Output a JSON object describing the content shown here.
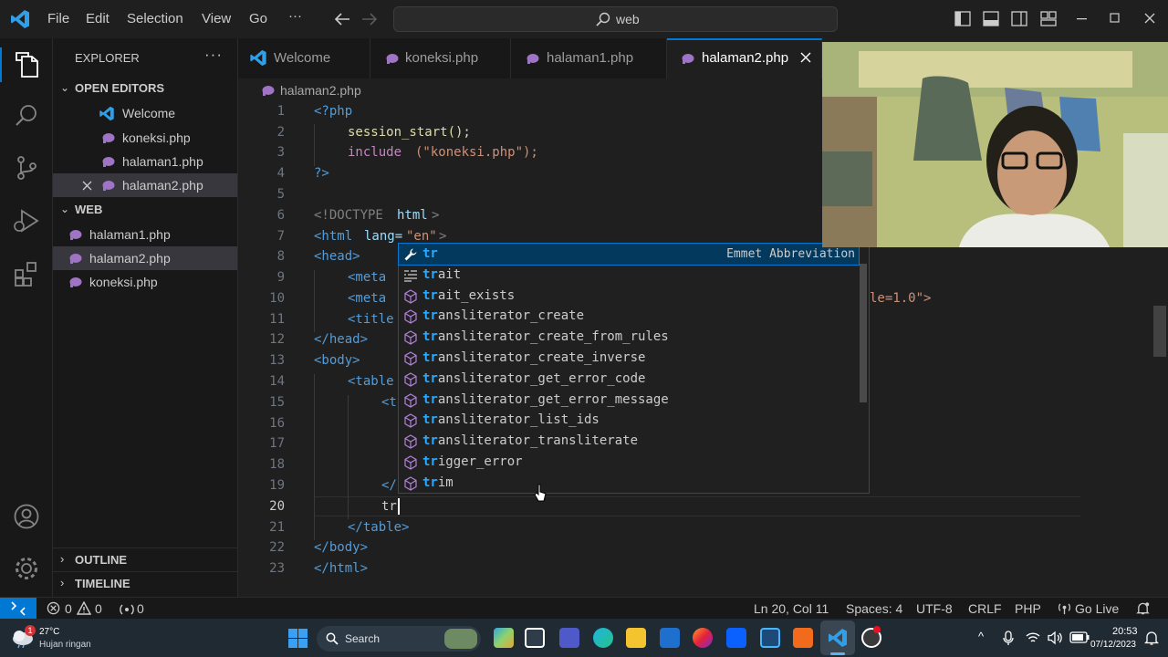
{
  "menu": {
    "file": "File",
    "edit": "Edit",
    "selection": "Selection",
    "view": "View",
    "go": "Go",
    "more": "···"
  },
  "search": {
    "text": "web"
  },
  "explorer": {
    "title": "EXPLORER",
    "open_editors_title": "OPEN EDITORS",
    "open_editors": [
      "Welcome",
      "koneksi.php",
      "halaman1.php",
      "halaman2.php"
    ],
    "folder_title": "WEB",
    "files": [
      "halaman1.php",
      "halaman2.php",
      "koneksi.php"
    ],
    "outline": "OUTLINE",
    "timeline": "TIMELINE"
  },
  "tabs": [
    {
      "label": "Welcome"
    },
    {
      "label": "koneksi.php"
    },
    {
      "label": "halaman1.php"
    },
    {
      "label": "halaman2.php"
    }
  ],
  "breadcrumb": "halaman2.php",
  "editor": {
    "line_numbers": [
      "1",
      "2",
      "3",
      "4",
      "5",
      "6",
      "7",
      "8",
      "9",
      "10",
      "11",
      "12",
      "13",
      "14",
      "15",
      "16",
      "17",
      "18",
      "19",
      "20",
      "21",
      "22",
      "23"
    ],
    "visible_fragments": {
      "l1": "<?php",
      "l2": "session_start();",
      "l3a": "include",
      "l3b": "(\"koneksi.php\");",
      "l4": "?>",
      "l6a": "<!DOCTYPE",
      "l6b": "html",
      "l6c": ">",
      "l7a": "<html",
      "l7b": "lang=",
      "l7c": "\"en\"",
      "l7d": ">",
      "l8": "<head>",
      "l9": "<meta",
      "l10": "<meta",
      "l10tail": "le=1.0\">",
      "l11": "<title",
      "l12": "</head>",
      "l13": "<body>",
      "l14": "<table",
      "l15": "<t",
      "l19": "</",
      "l20": "tr",
      "l21": "</table>",
      "l22": "</body>",
      "l23": "</html>"
    }
  },
  "suggestions": {
    "header_detail": "Emmet Abbreviation",
    "items": [
      {
        "match": "tr",
        "rest": ""
      },
      {
        "match": "tr",
        "rest": "ait"
      },
      {
        "match": "tr",
        "rest": "ait_exists"
      },
      {
        "match": "tr",
        "rest": "ansliterator_create"
      },
      {
        "match": "tr",
        "rest": "ansliterator_create_from_rules"
      },
      {
        "match": "tr",
        "rest": "ansliterator_create_inverse"
      },
      {
        "match": "tr",
        "rest": "ansliterator_get_error_code"
      },
      {
        "match": "tr",
        "rest": "ansliterator_get_error_message"
      },
      {
        "match": "tr",
        "rest": "ansliterator_list_ids"
      },
      {
        "match": "tr",
        "rest": "ansliterator_transliterate"
      },
      {
        "match": "tr",
        "rest": "igger_error"
      },
      {
        "match": "tr",
        "rest": "im"
      }
    ]
  },
  "status": {
    "errors": "0",
    "warnings": "0",
    "ports": "0",
    "position": "Ln 20, Col 11",
    "spaces": "Spaces: 4",
    "encoding": "UTF-8",
    "eol": "CRLF",
    "language": "PHP",
    "golive": "Go Live"
  },
  "taskbar": {
    "weather_temp": "27°C",
    "weather_desc": "Hujan ringan",
    "weather_badge": "1",
    "search_label": "Search",
    "time": "20:53",
    "date": "07/12/2023"
  },
  "colors": {
    "accent": "#0078d4",
    "php_icon": "#a074c4",
    "vscode_blue": "#2e9fe8"
  }
}
